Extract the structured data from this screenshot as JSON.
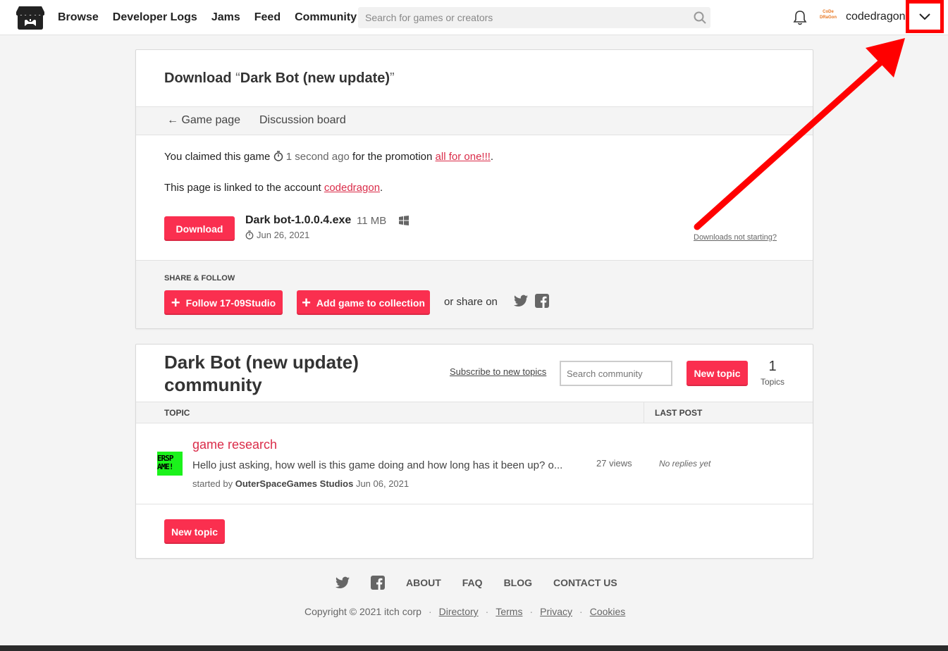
{
  "header": {
    "nav": [
      "Browse",
      "Developer Logs",
      "Jams",
      "Feed",
      "Community"
    ],
    "search_placeholder": "Search for games or creators",
    "avatar_text": "CoDe DRaGon",
    "username": "codedragon"
  },
  "download": {
    "title_prefix": "Download ",
    "quote_open": "“",
    "game_name": "Dark Bot (new update)",
    "quote_close": "”",
    "subnav": {
      "game_page": "← Game page",
      "discussion": "Discussion board"
    },
    "claim": {
      "prefix": "You claimed this game ",
      "time": "1 second ago",
      "middle": " for the promotion ",
      "promo": "all for one!!!",
      "suffix": "."
    },
    "linked": {
      "prefix": "This page is linked to the account ",
      "account": "codedragon",
      "suffix": "."
    },
    "button": "Download",
    "file": {
      "name": "Dark bot-1.0.0.4.exe",
      "size": "11 MB",
      "date": "Jun 26, 2021",
      "platform_icon": "windows-icon"
    },
    "not_starting": "Downloads not starting?"
  },
  "share": {
    "label": "SHARE & FOLLOW",
    "follow": "Follow 17-09Studio",
    "collection": "Add game to collection",
    "or_share": "or share on"
  },
  "community": {
    "title": "Dark Bot (new update) community",
    "subscribe": "Subscribe to new topics",
    "search_placeholder": "Search community",
    "new_topic": "New topic",
    "topic_count": "1",
    "topic_count_label": "Topics",
    "columns": {
      "topic": "TOPIC",
      "last_post": "LAST POST"
    },
    "topics": [
      {
        "avatar_lines": [
          "ERSP",
          "AME!"
        ],
        "title": "game research",
        "preview": "Hello just asking, how well is this game doing and how long has it been up? o...",
        "started_by": "started by ",
        "author": "OuterSpaceGames Studios",
        "date": " Jun 06, 2021",
        "views": "27 views",
        "last_post": "No replies yet"
      }
    ],
    "new_topic_bottom": "New topic"
  },
  "footer": {
    "links": [
      "ABOUT",
      "FAQ",
      "BLOG",
      "CONTACT US"
    ],
    "copyright": "Copyright © 2021 itch corp",
    "legal": [
      "Directory",
      "Terms",
      "Privacy",
      "Cookies"
    ],
    "separator": "·"
  },
  "colors": {
    "accent": "#fa2f4f",
    "link": "#da2c49",
    "annotation": "#ff0000"
  }
}
